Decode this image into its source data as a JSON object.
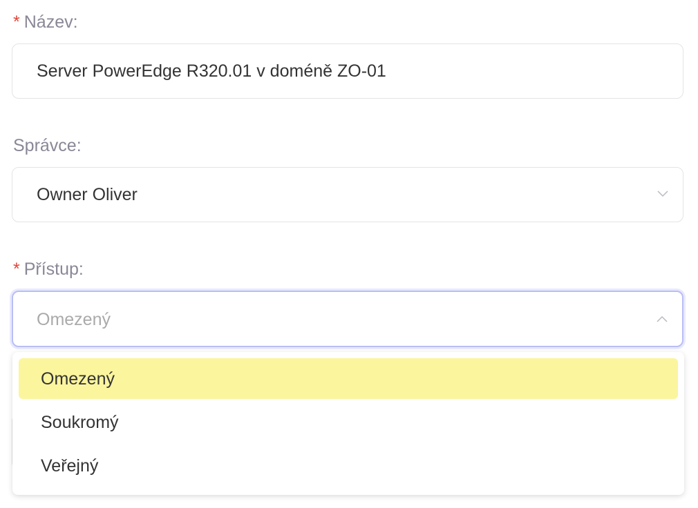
{
  "name_field": {
    "label": "Název:",
    "required": true,
    "value": "Server PowerEdge R320.01 v doméně ZO-01"
  },
  "admin_field": {
    "label": "Správce:",
    "value": "Owner Oliver",
    "icon": "chevron-down-icon"
  },
  "access_field": {
    "label": "Přístup:",
    "required": true,
    "placeholder": "Omezený",
    "icon": "chevron-up-icon",
    "options": [
      {
        "label": "Omezený",
        "highlighted": true
      },
      {
        "label": "Soukromý"
      },
      {
        "label": "Veřejný"
      }
    ]
  },
  "required_mark": "*",
  "colors": {
    "required": "#e0463a",
    "highlight": "#fbf59e",
    "focus_border": "#b9bdf5"
  }
}
